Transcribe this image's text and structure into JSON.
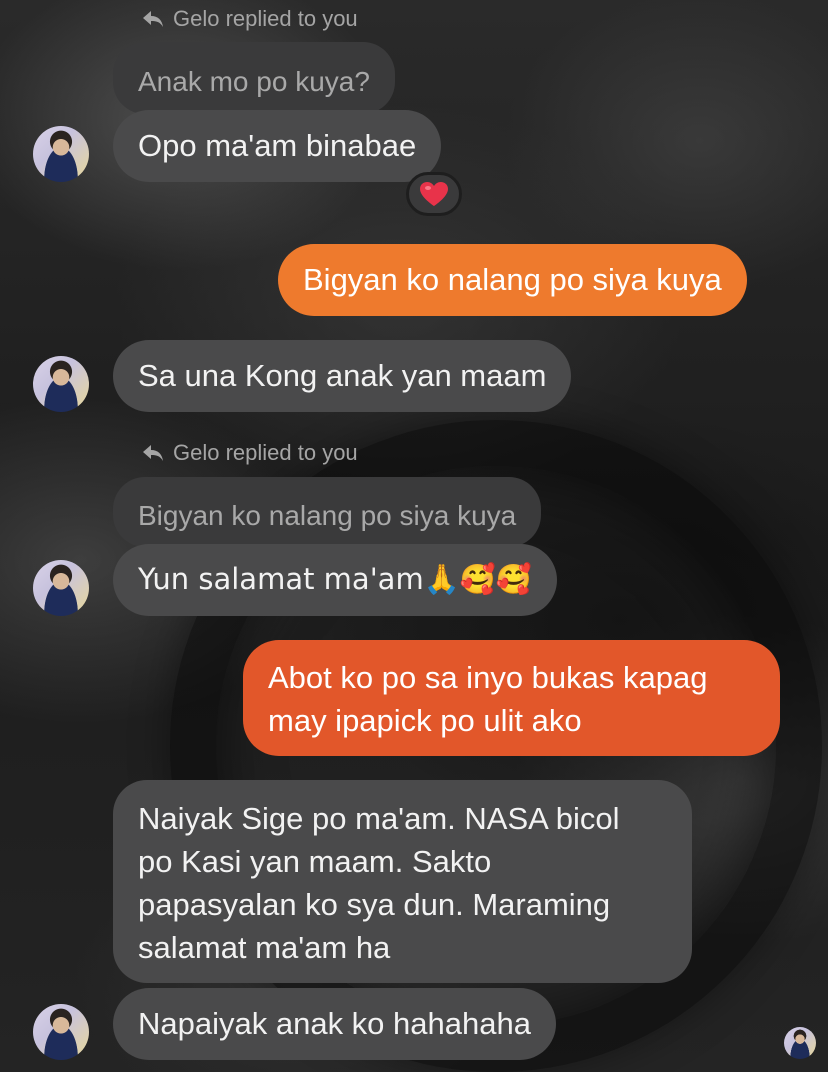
{
  "thread": {
    "reply_note_1": "Gelo replied to you",
    "quoted_1": "Anak mo po kuya?",
    "msg_1": "Opo ma'am binabae",
    "reaction_1": "heart-icon",
    "out_1": "Bigyan ko nalang po siya kuya",
    "msg_2": "Sa una Kong anak yan maam",
    "reply_note_2": "Gelo replied to you",
    "quoted_2": "Bigyan ko nalang po siya kuya",
    "msg_3": "Yun salamat ma'am🙏🥰🥰",
    "out_2_line_1": "Abot ko po sa inyo bukas kapag",
    "out_2_line_2": "may ipapick po ulit ako",
    "msg_4_line_1": "Naiyak Sige po ma'am. NASA bicol",
    "msg_4_line_2": "po Kasi yan maam. Sakto",
    "msg_4_line_3": "papasyalan ko sya dun. Maraming",
    "msg_4_line_4": "salamat ma'am ha",
    "msg_5": "Napaiyak anak ko hahahaha"
  },
  "colors": {
    "incoming_bubble": "#4a4a4b",
    "quoted_bubble": "#3a3a3b",
    "outgoing_light": "#ee7a2d",
    "outgoing_dark": "#e2572a",
    "reaction_heart": "#e8334a"
  }
}
